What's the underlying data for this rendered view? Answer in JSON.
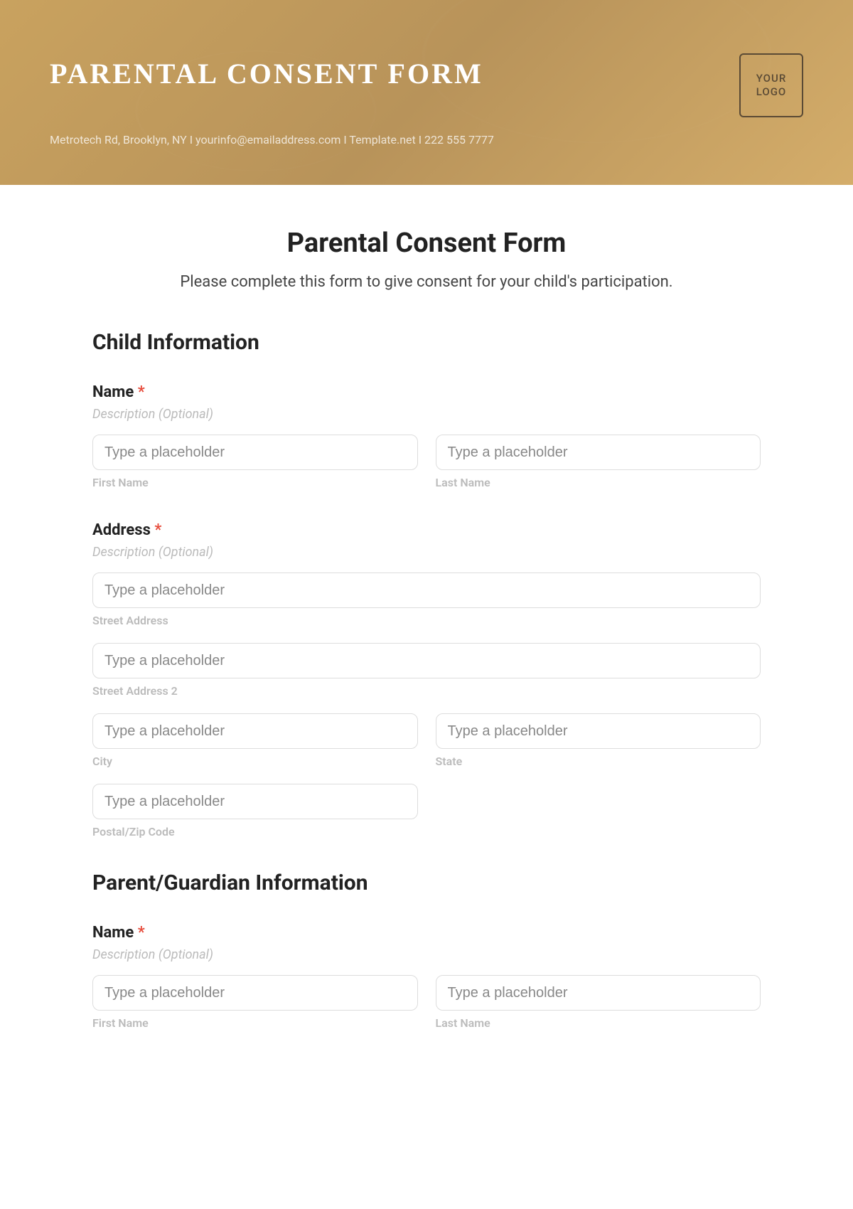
{
  "banner": {
    "title": "PARENTAL CONSENT FORM",
    "contact": "Metrotech Rd, Brooklyn, NY  I  yourinfo@emailaddress.com  I  Template.net  I  222 555 7777",
    "logo_line1": "YOUR",
    "logo_line2": "LOGO"
  },
  "form": {
    "title": "Parental Consent Form",
    "intro": "Please complete this form to give consent for your child's participation."
  },
  "child": {
    "section_title": "Child Information",
    "name": {
      "label": "Name",
      "required": "*",
      "desc": "Description (Optional)",
      "first_placeholder": "Type a placeholder",
      "first_sublabel": "First Name",
      "last_placeholder": "Type a placeholder",
      "last_sublabel": "Last Name"
    },
    "address": {
      "label": "Address",
      "required": "*",
      "desc": "Description (Optional)",
      "street_placeholder": "Type a placeholder",
      "street_sublabel": "Street Address",
      "street2_placeholder": "Type a placeholder",
      "street2_sublabel": "Street Address 2",
      "city_placeholder": "Type a placeholder",
      "city_sublabel": "City",
      "state_placeholder": "Type a placeholder",
      "state_sublabel": "State",
      "postal_placeholder": "Type a placeholder",
      "postal_sublabel": "Postal/Zip Code"
    }
  },
  "parent": {
    "section_title": "Parent/Guardian Information",
    "name": {
      "label": "Name",
      "required": "*",
      "desc": "Description (Optional)",
      "first_placeholder": "Type a placeholder",
      "first_sublabel": "First Name",
      "last_placeholder": "Type a placeholder",
      "last_sublabel": "Last Name"
    }
  }
}
